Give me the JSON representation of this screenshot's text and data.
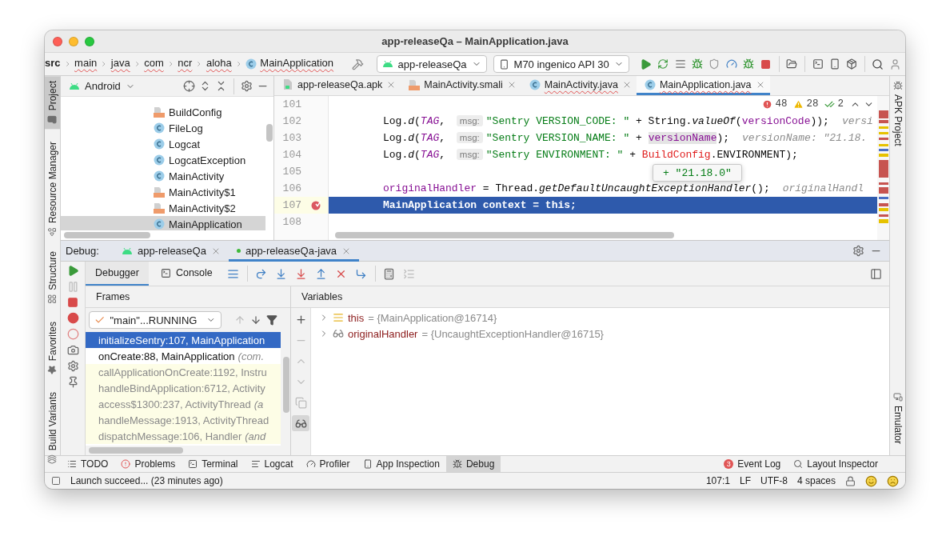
{
  "window": {
    "title": "app-releaseQa – MainApplication.java"
  },
  "breadcrumbs": [
    {
      "label": "src",
      "kind": "folder",
      "error": false
    },
    {
      "label": "main",
      "kind": "folder",
      "error": true
    },
    {
      "label": "java",
      "kind": "folder",
      "error": true
    },
    {
      "label": "com",
      "kind": "folder",
      "error": true
    },
    {
      "label": "ncr",
      "kind": "folder",
      "error": true
    },
    {
      "label": "aloha",
      "kind": "folder",
      "error": true
    },
    {
      "label": "MainApplication",
      "kind": "class",
      "error": true
    }
  ],
  "run_config": "app-releaseQa",
  "device": "M70 ingenico API 30",
  "left_stripe": {
    "top": [
      {
        "label": "Project",
        "kind": "folder",
        "selected": true
      },
      {
        "label": "Resource Manager",
        "kind": "shapes",
        "selected": false
      }
    ],
    "bottom": [
      {
        "label": "Structure",
        "kind": "structure",
        "selected": false
      },
      {
        "label": "Favorites",
        "kind": "star",
        "selected": false
      },
      {
        "label": "Build Variants",
        "kind": "variants",
        "selected": false
      }
    ]
  },
  "right_stripe": [
    {
      "label": "APK Project",
      "kind": "apk"
    },
    {
      "label": "Emulator",
      "kind": "device"
    }
  ],
  "project": {
    "view": "Android",
    "items": [
      {
        "label": "BuildConfig",
        "kind": "smali",
        "selected": false
      },
      {
        "label": "FileLog",
        "kind": "class",
        "selected": false
      },
      {
        "label": "Logcat",
        "kind": "class",
        "selected": false
      },
      {
        "label": "LogcatException",
        "kind": "class",
        "selected": false
      },
      {
        "label": "MainActivity",
        "kind": "class",
        "selected": false
      },
      {
        "label": "MainActivity$1",
        "kind": "smali",
        "selected": false
      },
      {
        "label": "MainActivity$2",
        "kind": "smali",
        "selected": false
      },
      {
        "label": "MainApplication",
        "kind": "class",
        "selected": true
      }
    ]
  },
  "editor_tabs": [
    {
      "label": "app-releaseQa.apk",
      "kind": "apk",
      "selected": false,
      "error": false
    },
    {
      "label": "MainActivity.smali",
      "kind": "smali",
      "selected": false,
      "error": false
    },
    {
      "label": "MainActivity.java",
      "kind": "class",
      "selected": false,
      "error": true
    },
    {
      "label": "MainApplication.java",
      "kind": "class",
      "selected": true,
      "error": true
    }
  ],
  "inspections": {
    "errors": "48",
    "warnings": "28",
    "weak_warnings": "2"
  },
  "code_lines": [
    {
      "number": "101",
      "current": false,
      "breakpoint": false
    },
    {
      "number": "102",
      "current": false,
      "breakpoint": false,
      "tokens": [
        {
          "kind": "plain",
          "text": "Log."
        },
        {
          "kind": "call",
          "text": "d"
        },
        {
          "kind": "plain",
          "text": "("
        },
        {
          "kind": "constant",
          "text": "TAG"
        },
        {
          "kind": "plain",
          "text": ", "
        },
        {
          "kind": "hint",
          "text": "msg:"
        },
        {
          "kind": "string",
          "text": "\"Sentry VERSION_CODE: \""
        },
        {
          "kind": "plain",
          "text": " + String."
        },
        {
          "kind": "call",
          "text": "valueOf"
        },
        {
          "kind": "plain",
          "text": "("
        },
        {
          "kind": "field",
          "text": "versionCode"
        },
        {
          "kind": "plain",
          "text": "));"
        },
        {
          "kind": "inlay",
          "text": "versi"
        }
      ]
    },
    {
      "number": "103",
      "current": false,
      "breakpoint": false,
      "tokens": [
        {
          "kind": "plain",
          "text": "Log."
        },
        {
          "kind": "call",
          "text": "d"
        },
        {
          "kind": "plain",
          "text": "("
        },
        {
          "kind": "constant",
          "text": "TAG"
        },
        {
          "kind": "plain",
          "text": ", "
        },
        {
          "kind": "hint",
          "text": "msg:"
        },
        {
          "kind": "string",
          "text": "\"Sentry VERSION_NAME: \""
        },
        {
          "kind": "plain",
          "text": " + "
        },
        {
          "kind": "hovered",
          "text": "versionName"
        },
        {
          "kind": "plain",
          "text": ");"
        },
        {
          "kind": "inlay",
          "text": "versionName: \"21.18."
        }
      ]
    },
    {
      "number": "104",
      "current": false,
      "breakpoint": false,
      "tokens": [
        {
          "kind": "plain",
          "text": "Log."
        },
        {
          "kind": "call",
          "text": "d"
        },
        {
          "kind": "plain",
          "text": "("
        },
        {
          "kind": "constant",
          "text": "TAG"
        },
        {
          "kind": "plain",
          "text": ", "
        },
        {
          "kind": "hint",
          "text": "msg:"
        },
        {
          "kind": "string",
          "text": "\"Sentry ENVIRONMENT: \""
        },
        {
          "kind": "plain",
          "text": " + "
        },
        {
          "kind": "error",
          "text": "BuildConfig"
        },
        {
          "kind": "plain",
          "text": ".ENVIRONMENT);"
        }
      ]
    },
    {
      "number": "105",
      "current": false,
      "breakpoint": false
    },
    {
      "number": "106",
      "current": false,
      "breakpoint": false,
      "tokens": [
        {
          "kind": "field",
          "text": "originalHandler"
        },
        {
          "kind": "plain",
          "text": " = Thread."
        },
        {
          "kind": "call",
          "text": "getDefaultUncaughtExceptionHandler"
        },
        {
          "kind": "plain",
          "text": "();"
        },
        {
          "kind": "inlay",
          "text": "originalHandl"
        }
      ]
    },
    {
      "number": "107",
      "current": true,
      "breakpoint": true,
      "tokens": [
        {
          "kind": "plain",
          "text": "MainApplication context = "
        },
        {
          "kind": "keyword",
          "text": "this"
        },
        {
          "kind": "plain",
          "text": ";"
        }
      ]
    },
    {
      "number": "108",
      "current": false,
      "breakpoint": false
    }
  ],
  "value_tooltip": "+ \"21.18.0\"",
  "debug": {
    "label": "Debug:",
    "sessions": [
      {
        "label": "app-releaseQa",
        "selected": false
      },
      {
        "label": "app-releaseQa-java",
        "selected": true
      }
    ],
    "tabs": [
      {
        "label": "Debugger",
        "kind": "debugger",
        "selected": true
      },
      {
        "label": "Console",
        "kind": "console",
        "selected": false
      }
    ],
    "frames_title": "Frames",
    "thread": "\"main\"...RUNNING",
    "frames": [
      {
        "method": "initializeSentry:107, MainApplication",
        "selected": true,
        "library": false
      },
      {
        "method": "onCreate:88, MainApplication",
        "package": "(com.",
        "selected": false,
        "library": false
      },
      {
        "method": "callApplicationOnCreate:1192, Instru",
        "selected": false,
        "library": true
      },
      {
        "method": "handleBindApplication:6712, Activity",
        "selected": false,
        "library": true
      },
      {
        "method": "access$1300:237, ActivityThread",
        "package": "(a",
        "selected": false,
        "library": true
      },
      {
        "method": "handleMessage:1913, ActivityThread",
        "selected": false,
        "library": true
      },
      {
        "method": "dispatchMessage:106, Handler",
        "package": "(and",
        "selected": false,
        "library": true
      }
    ],
    "variables_title": "Variables",
    "variables": [
      {
        "name": "this",
        "value": "= {MainApplication@16714}",
        "kind": "object"
      },
      {
        "name": "originalHandler",
        "value": "= {UncaughtExceptionHandler@16715}",
        "kind": "watch"
      }
    ]
  },
  "tool_windows": {
    "left": [
      {
        "label": "TODO",
        "kind": "todo",
        "selected": false
      },
      {
        "label": "Problems",
        "kind": "problems",
        "selected": false
      },
      {
        "label": "Terminal",
        "kind": "terminal",
        "selected": false
      },
      {
        "label": "Logcat",
        "kind": "logcat",
        "selected": false
      },
      {
        "label": "Profiler",
        "kind": "profiler",
        "selected": false
      },
      {
        "label": "App Inspection",
        "kind": "inspection",
        "selected": false
      },
      {
        "label": "Debug",
        "kind": "debug",
        "selected": true
      }
    ],
    "right": [
      {
        "label": "Event Log",
        "kind": "eventlog",
        "badge": "3",
        "selected": false
      },
      {
        "label": "Layout Inspector",
        "kind": "layout",
        "selected": false
      }
    ]
  },
  "status_bar": {
    "message": "Launch succeed... (23 minutes ago)",
    "position": "107:1",
    "line_ending": "LF",
    "encoding": "UTF-8",
    "indent": "4 spaces"
  }
}
